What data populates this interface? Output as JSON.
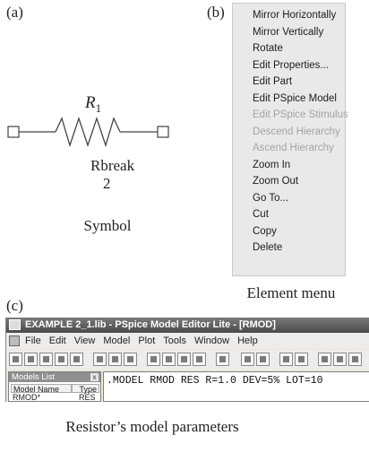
{
  "panel_labels": {
    "a": "(a)",
    "b": "(b)",
    "c": "(c)"
  },
  "symbol": {
    "ref_letter": "R",
    "ref_index": "1",
    "part_name": "Rbreak",
    "pin_count": "2",
    "caption": "Symbol"
  },
  "context_menu": {
    "items": [
      {
        "label": "Mirror Horizontally",
        "enabled": true
      },
      {
        "label": "Mirror Vertically",
        "enabled": true
      },
      {
        "label": "Rotate",
        "enabled": true
      },
      {
        "label": "Edit Properties...",
        "enabled": true
      },
      {
        "label": "Edit Part",
        "enabled": true
      },
      {
        "label": "Edit PSpice Model",
        "enabled": true
      },
      {
        "label": "Edit PSpice Stimulus",
        "enabled": false
      },
      {
        "label": "Descend Hierarchy",
        "enabled": false
      },
      {
        "label": "Ascend Hierarchy",
        "enabled": false
      },
      {
        "label": "Zoom In",
        "enabled": true
      },
      {
        "label": "Zoom Out",
        "enabled": true
      },
      {
        "label": "Go To...",
        "enabled": true
      },
      {
        "label": "Cut",
        "enabled": true
      },
      {
        "label": "Copy",
        "enabled": true
      },
      {
        "label": "Delete",
        "enabled": true
      }
    ],
    "caption": "Element menu"
  },
  "editor_window": {
    "title": "EXAMPLE 2_1.lib - PSpice Model Editor Lite - [RMOD]",
    "menus": [
      "File",
      "Edit",
      "View",
      "Model",
      "Plot",
      "Tools",
      "Window",
      "Help"
    ],
    "models_list": {
      "title": "Models List",
      "close_glyph": "x",
      "headers": [
        "Model Name",
        "Type"
      ],
      "rows": [
        {
          "name": "RMOD*",
          "type": "RES"
        }
      ]
    },
    "model_text": ".MODEL RMOD RES R=1.0 DEV=5% LOT=10"
  },
  "bottom_caption": "Resistor’s model parameters",
  "colors": {
    "menu_bg": "#e9e9e9",
    "menu_disabled": "#a4a4a4",
    "title_bar": "#5a5a5a",
    "window_bg": "#ece9d8"
  },
  "icons": [
    "resistor-symbol-icon",
    "app-icon",
    "document-icon"
  ]
}
